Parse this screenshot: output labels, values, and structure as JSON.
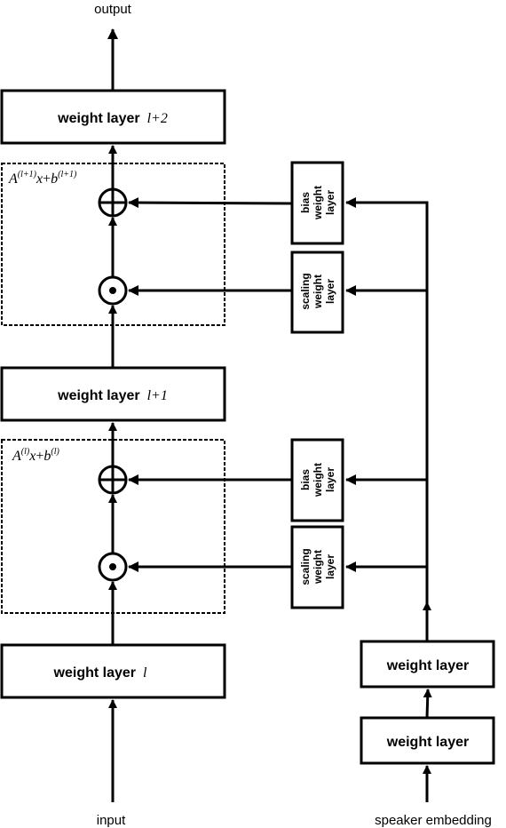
{
  "diagram": {
    "io": {
      "output_label": "output",
      "input_label": "input",
      "speaker_label": "speaker embedding"
    },
    "main_layers": [
      {
        "text": "weight layer",
        "index": "l+2"
      },
      {
        "text": "weight layer",
        "index": "l+1"
      },
      {
        "text": "weight layer",
        "index": "l"
      }
    ],
    "affine_blocks": [
      {
        "formula_A": "A",
        "sup_A": "(l+1)",
        "var": "x",
        "plus": "+",
        "formula_b": "b",
        "sup_b": "(l+1)"
      },
      {
        "formula_A": "A",
        "sup_A": "(l)",
        "var": "x",
        "plus": "+",
        "formula_b": "b",
        "sup_b": "(l)"
      }
    ],
    "side_layers": {
      "bias": [
        "bias",
        "weight",
        "layer"
      ],
      "scaling": [
        "scaling",
        "weight",
        "layer"
      ]
    },
    "speaker_layers": [
      {
        "text": "weight layer"
      },
      {
        "text": "weight layer"
      }
    ],
    "operators": {
      "add": "elementwise-add",
      "multiply": "elementwise-multiply"
    },
    "colors": {
      "stroke": "#000000",
      "background": "#ffffff"
    }
  }
}
